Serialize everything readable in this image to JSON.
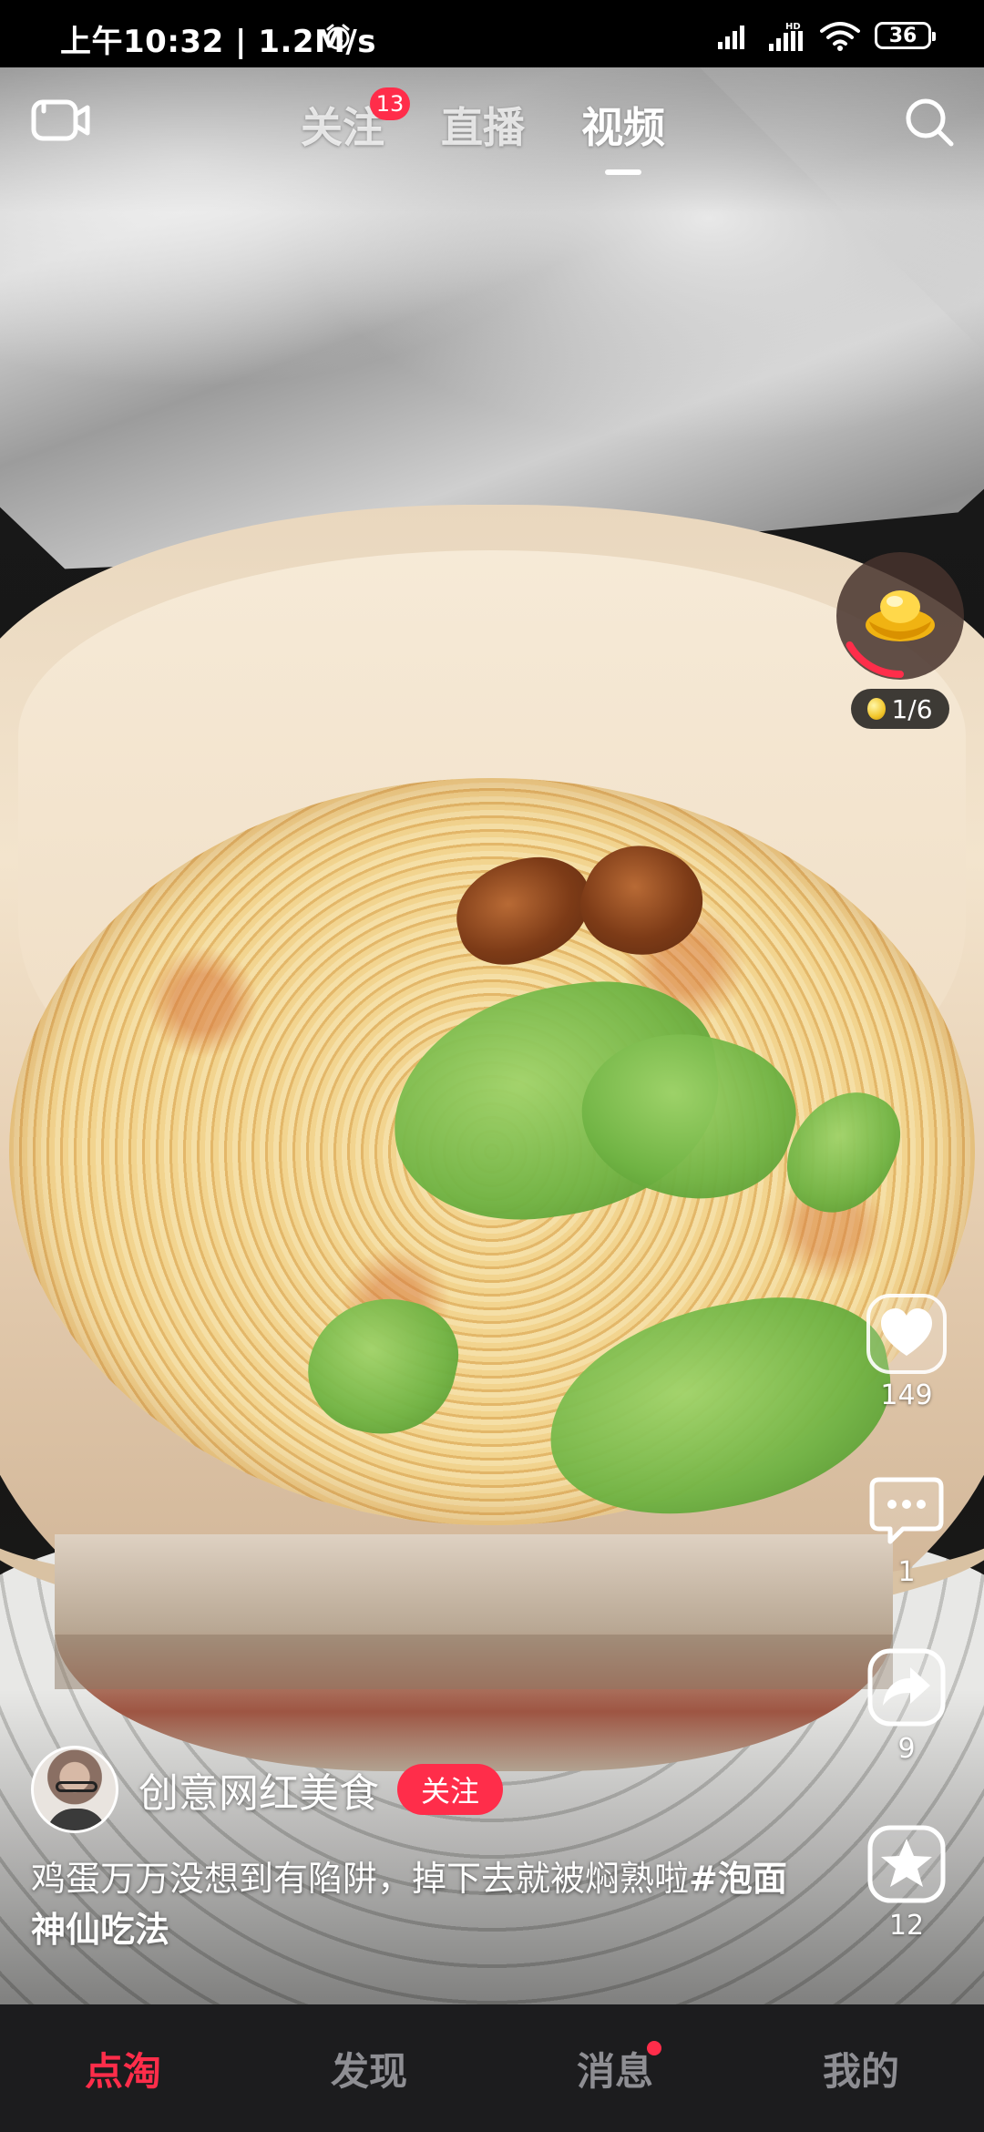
{
  "status_bar": {
    "time": "上午10:32 | 1.2M/s",
    "battery": "36"
  },
  "top_nav": {
    "tabs": [
      {
        "label": "关注",
        "badge": "13"
      },
      {
        "label": "直播"
      },
      {
        "label": "视频"
      }
    ]
  },
  "coins": {
    "count": "1/6",
    "progress": 0.1667
  },
  "actions": {
    "likes": "149",
    "comments": "1",
    "shares": "9",
    "favorites": "12"
  },
  "author": {
    "name": "创意网红美食",
    "follow_label": "关注"
  },
  "caption": {
    "text": "鸡蛋万万没想到有陷阱，掉下去就被焖熟啦",
    "hashtag": "#泡面神仙吃法"
  },
  "bottom_nav": {
    "items": [
      {
        "label": "点淘"
      },
      {
        "label": "发现"
      },
      {
        "label": "消息"
      },
      {
        "label": "我的"
      }
    ]
  },
  "colors": {
    "accent": "#ff2d4a",
    "nav_background": "#1c1c1e",
    "inactive_text": "#8e8e93"
  }
}
